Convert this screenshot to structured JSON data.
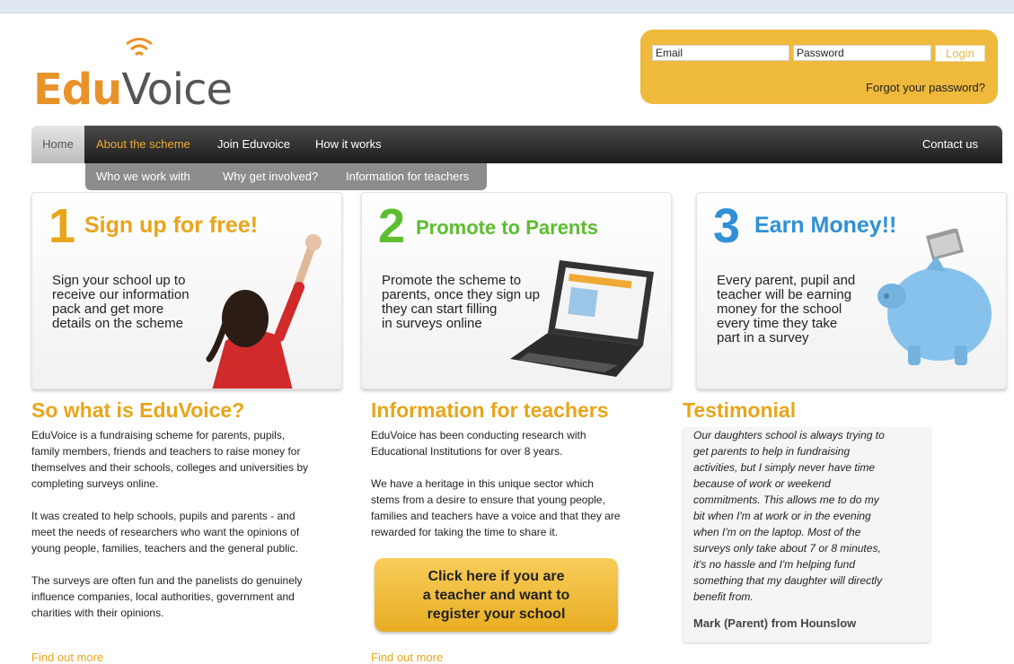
{
  "logo": {
    "edu": "Edu",
    "voice": "Voice"
  },
  "login": {
    "email_placeholder": "Email",
    "password_placeholder": "Password",
    "login_label": "Login",
    "forgot_label": "Forgot your password?"
  },
  "nav": {
    "items": [
      "Home",
      "About the scheme",
      "Join Eduvoice",
      "How it works"
    ],
    "contact": "Contact us",
    "active": "About the scheme",
    "subitems": [
      "Who we work with",
      "Why get involved?",
      "Information for teachers"
    ]
  },
  "panels": [
    {
      "number": "1",
      "title": "Sign up for free!",
      "lines": [
        "Sign your school up to",
        "receive our information",
        "pack and get more",
        "details on the scheme"
      ]
    },
    {
      "number": "2",
      "title": "Promote to Parents",
      "lines": [
        "Promote the scheme to",
        "parents, once they sign up",
        "they can start filling",
        "in surveys online"
      ]
    },
    {
      "number": "3",
      "title": "Earn Money!!",
      "lines": [
        "Every parent, pupil and",
        "teacher will be earning",
        "money for the school",
        "every time they take",
        "part in a survey"
      ]
    }
  ],
  "about": {
    "heading": "So what is EduVoice?",
    "paragraphs": [
      [
        "EduVoice is a fundraising scheme for parents, pupils,",
        "family members, friends and teachers to raise money for",
        "themselves and their schools, colleges and universities by",
        "completing surveys online."
      ],
      [
        "It was created to help schools, pupils and parents - and",
        "meet the needs of researchers who want the opinions of",
        "young people, families, teachers and the general public."
      ],
      [
        "The surveys are often fun and the panelists do genuinely",
        "influence companies, local authorities, government and",
        "charities with their opinions."
      ]
    ],
    "find_more": "Find out more"
  },
  "teachers": {
    "heading": "Information for teachers",
    "paragraphs": [
      [
        "EduVoice has been conducting research with",
        "Educational Institutions for over 8 years."
      ],
      [
        "We have a heritage in this unique sector which",
        "stems from a desire to ensure that young people,",
        "families and teachers have a voice and that they are",
        "rewarded for taking the time to share it."
      ]
    ],
    "cta_lines": [
      "Click here if you are",
      "a teacher and want to",
      "register your school"
    ],
    "find_more": "Find out more"
  },
  "testimonial": {
    "heading": "Testimonial",
    "lines": [
      "Our daughters school is always trying to",
      "get parents to help in fundraising",
      "activities, but I simply never have time",
      "because of work or weekend",
      "commitments. This allows me to do my",
      "bit when I'm at work or in the evening",
      "when I'm on the laptop. Most of the",
      "surveys only take about 7 or 8 minutes,",
      "it's no hassle and I'm helping fund",
      "something that my daughter will directly",
      "benefit from."
    ],
    "author": "Mark (Parent) from Hounslow"
  },
  "colors": {
    "orange": "#e8a51a",
    "green": "#5cbd2f",
    "blue": "#2f90d6",
    "nav_dark": "#1c1c1c",
    "login_bg": "#efb93b"
  }
}
